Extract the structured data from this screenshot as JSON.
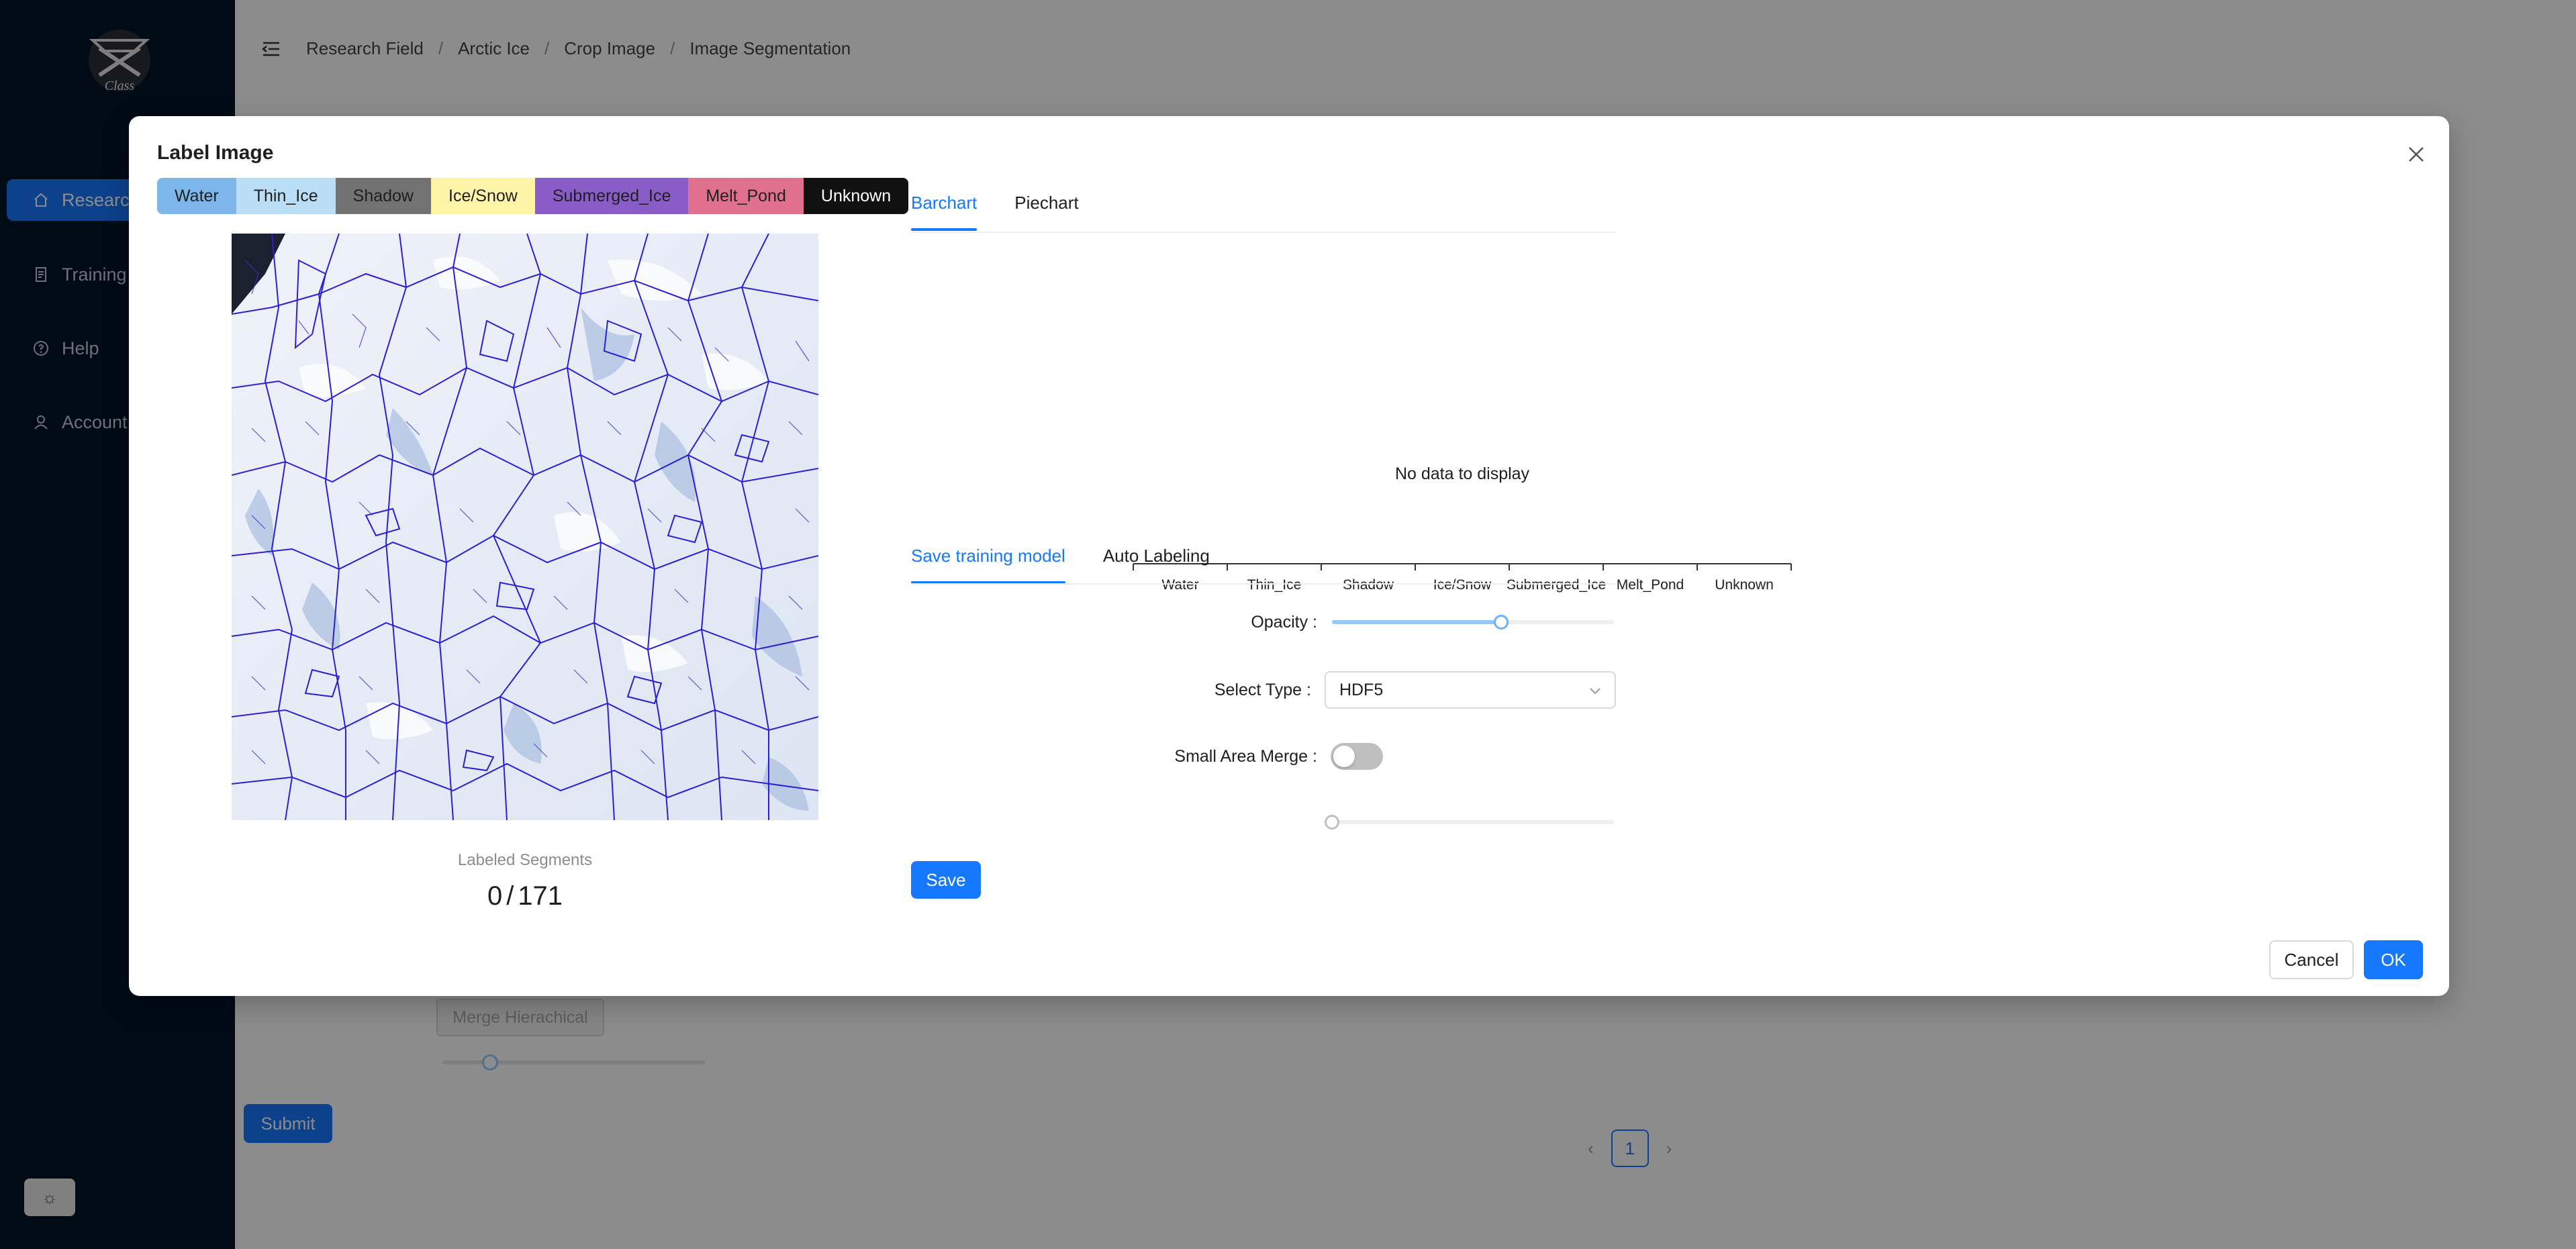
{
  "app": {
    "logo_text": "Class",
    "theme_icon": "sun-icon"
  },
  "sidebar": {
    "items": [
      {
        "label": "Research",
        "icon": "home-icon"
      },
      {
        "label": "Training",
        "icon": "file-icon"
      },
      {
        "label": "Help",
        "icon": "question-circle-icon"
      },
      {
        "label": "Account",
        "icon": "user-icon"
      }
    ]
  },
  "header": {
    "menu_icon": "menu-fold-icon",
    "breadcrumb": [
      "Research Field",
      "Arctic Ice",
      "Crop Image",
      "Image Segmentation"
    ]
  },
  "background": {
    "merge_button": "Merge Hierachical",
    "submit_button": "Submit",
    "pagination": {
      "current": "1"
    }
  },
  "modal": {
    "title": "Label Image",
    "close_icon": "close-icon",
    "classes": [
      {
        "label": "Water",
        "color": "#7cb6ea"
      },
      {
        "label": "Thin_Ice",
        "color": "#b9def6"
      },
      {
        "label": "Shadow",
        "color": "#727272"
      },
      {
        "label": "Ice/Snow",
        "color": "#fff4a8"
      },
      {
        "label": "Submerged_Ice",
        "color": "#8a5cc8"
      },
      {
        "label": "Melt_Pond",
        "color": "#e0718c"
      },
      {
        "label": "Unknown",
        "color": "#111111"
      }
    ],
    "labeled_segments": {
      "caption": "Labeled Segments",
      "labeled": "0",
      "total": "171"
    },
    "chart_tabs": [
      {
        "label": "Barchart",
        "active": true
      },
      {
        "label": "Piechart",
        "active": false
      }
    ],
    "action_tabs": [
      {
        "label": "Save training model",
        "active": true
      },
      {
        "label": "Auto Labeling",
        "active": false
      }
    ],
    "form": {
      "opacity_label": "Opacity",
      "opacity_value": 0.6,
      "select_type_label": "Select Type",
      "select_type_value": "HDF5",
      "small_area_merge_label": "Small Area Merge",
      "small_area_merge_on": false,
      "small_area_value": 0
    },
    "save_button": "Save",
    "cancel_button": "Cancel",
    "ok_button": "OK"
  },
  "chart_data": {
    "type": "bar",
    "categories": [
      "Water",
      "Thin_Ice",
      "Shadow",
      "Ice/Snow",
      "Submerged_Ice",
      "Melt_Pond",
      "Unknown"
    ],
    "values": [],
    "empty_message": "No data to display"
  }
}
